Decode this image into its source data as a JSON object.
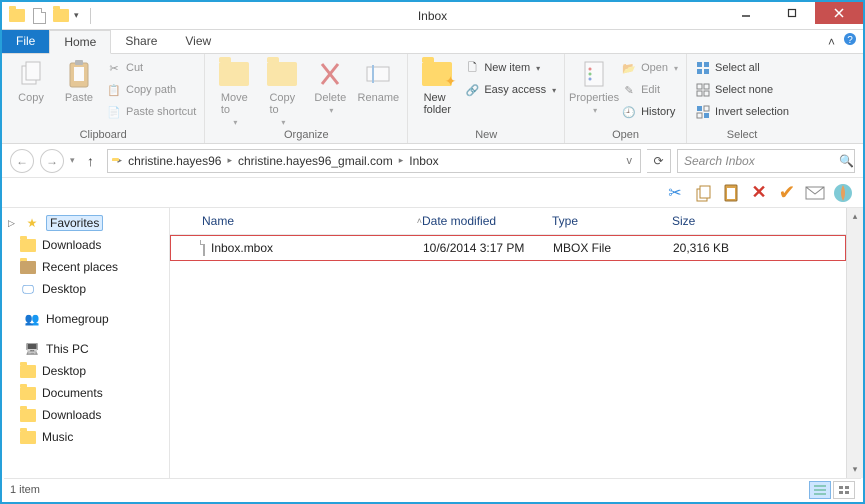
{
  "window": {
    "title": "Inbox"
  },
  "tabs": {
    "file": "File",
    "home": "Home",
    "share": "Share",
    "view": "View"
  },
  "ribbon": {
    "clipboard": {
      "label": "Clipboard",
      "copy": "Copy",
      "paste": "Paste",
      "cut": "Cut",
      "copy_path": "Copy path",
      "paste_shortcut": "Paste shortcut"
    },
    "organize": {
      "label": "Organize",
      "move_to": "Move\nto",
      "copy_to": "Copy\nto",
      "delete": "Delete",
      "rename": "Rename"
    },
    "new": {
      "label": "New",
      "new_folder": "New\nfolder",
      "new_item": "New item",
      "easy_access": "Easy access"
    },
    "open": {
      "label": "Open",
      "properties": "Properties",
      "open": "Open",
      "edit": "Edit",
      "history": "History"
    },
    "select": {
      "label": "Select",
      "select_all": "Select all",
      "select_none": "Select none",
      "invert": "Invert selection"
    }
  },
  "address": {
    "crumbs": [
      "christine.hayes96",
      "christine.hayes96_gmail.com",
      "Inbox"
    ],
    "search_placeholder": "Search Inbox"
  },
  "nav": {
    "favorites": "Favorites",
    "fav_items": [
      "Downloads",
      "Recent places",
      "Desktop"
    ],
    "homegroup": "Homegroup",
    "this_pc": "This PC",
    "pc_items": [
      "Desktop",
      "Documents",
      "Downloads",
      "Music"
    ]
  },
  "columns": {
    "name": "Name",
    "date": "Date modified",
    "type": "Type",
    "size": "Size"
  },
  "files": [
    {
      "name": "Inbox.mbox",
      "date": "10/6/2014 3:17 PM",
      "type": "MBOX File",
      "size": "20,316 KB"
    }
  ],
  "status": {
    "count": "1 item"
  }
}
